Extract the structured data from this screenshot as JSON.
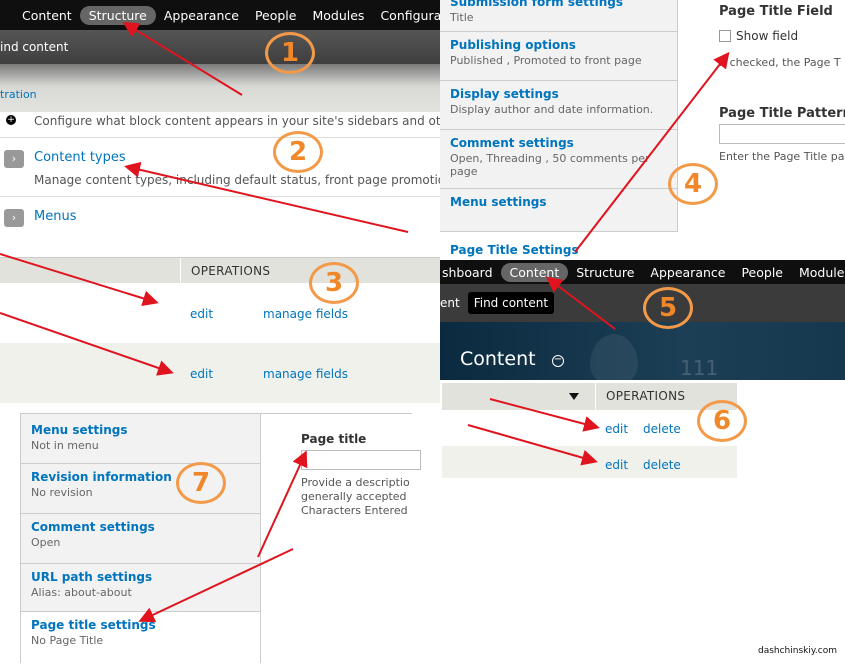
{
  "p1": {
    "toolbar_items": [
      "Content",
      "Structure",
      "Appearance",
      "People",
      "Modules",
      "Configuration"
    ],
    "shortcut": "ind content",
    "tration": "tration",
    "configure_text": "Configure what block content appears in your site's sidebars and othe",
    "content_types_label": "Content types",
    "content_types_desc": "Manage content types, including default status, front page promotion",
    "menus_label": "Menus"
  },
  "p3": {
    "operations_header": "OPERATIONS",
    "rows": [
      {
        "edit": "edit",
        "manage": "manage fields"
      },
      {
        "edit": "edit",
        "manage": "manage fields"
      }
    ]
  },
  "p4": {
    "tabs": [
      {
        "title": "Submission form settings",
        "sub": "Title"
      },
      {
        "title": "Publishing options",
        "sub": "Published , Promoted to front page"
      },
      {
        "title": "Display settings",
        "sub": "Display author and date information."
      },
      {
        "title": "Comment settings",
        "sub": "Open, Threading , 50 comments per page"
      },
      {
        "title": "Menu settings",
        "sub": ""
      }
    ],
    "last_tab": "Page Title Settings",
    "field_heading": "Page Title Field",
    "checkbox_label": "Show field",
    "checkbox_desc": "If checked, the Page T",
    "pattern_heading": "Page Title Pattern",
    "pattern_desc": "Enter the Page Title pa"
  },
  "p5": {
    "toolbar_items": [
      "shboard",
      "Content",
      "Structure",
      "Appearance",
      "People",
      "Modules"
    ],
    "shortcuts": [
      "ent",
      "Find content"
    ],
    "title": "Content",
    "bg_number": "111"
  },
  "p6": {
    "operations_header": "OPERATIONS",
    "rows": [
      {
        "edit": "edit",
        "delete": "delete"
      },
      {
        "edit": "edit",
        "delete": "delete"
      }
    ]
  },
  "p7": {
    "tabs": [
      {
        "title": "Menu settings",
        "sub": "Not in menu"
      },
      {
        "title": "Revision information",
        "sub": "No revision"
      },
      {
        "title": "Comment settings",
        "sub": "Open"
      },
      {
        "title": "URL path settings",
        "sub": "Alias: about-about"
      },
      {
        "title": "Page title settings",
        "sub": "No Page Title"
      }
    ],
    "field_heading": "Page title",
    "desc": [
      "Provide a descriptio",
      "generally accepted",
      "Characters Entered"
    ]
  },
  "badges": [
    "1",
    "2",
    "3",
    "4",
    "5",
    "6",
    "7"
  ],
  "watermark": "dashchinskiy.com",
  "colors": {
    "arrow": "#e0141e",
    "badge": "#f39a4a",
    "link": "#0074bd"
  }
}
